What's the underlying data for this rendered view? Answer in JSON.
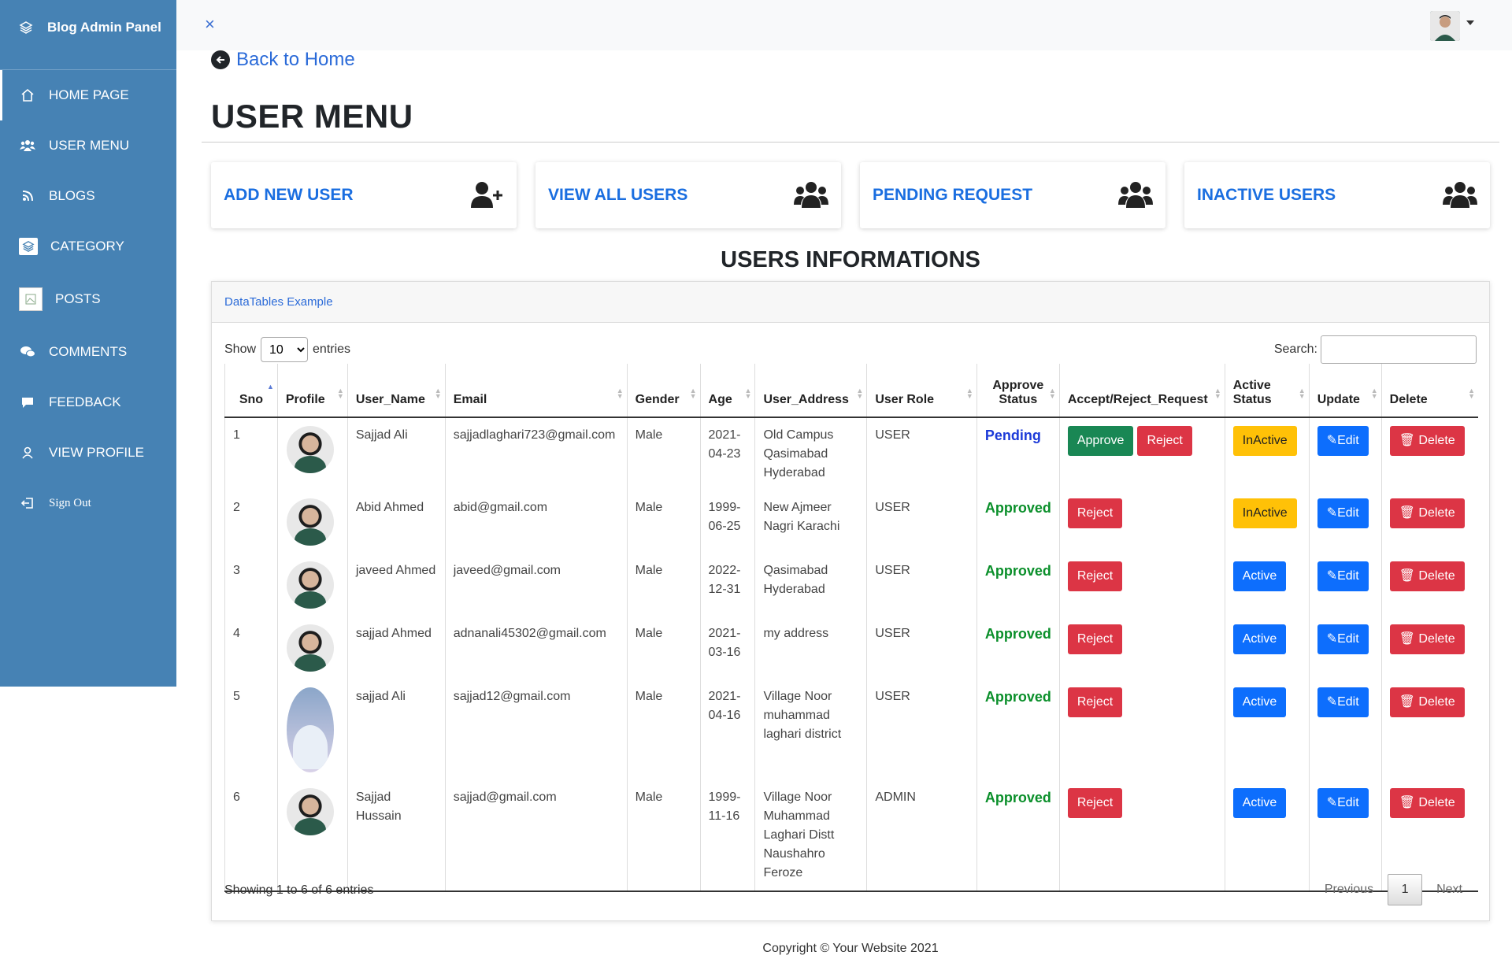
{
  "sidebar": {
    "brand": "Blog Admin Panel",
    "items": [
      {
        "label": "HOME PAGE",
        "icon": "home-icon"
      },
      {
        "label": "USER MENU",
        "icon": "users-icon"
      },
      {
        "label": "BLOGS",
        "icon": "blog-icon"
      },
      {
        "label": "CATEGORY",
        "icon": "layers-icon"
      },
      {
        "label": "POSTS",
        "icon": "broken-image-icon"
      },
      {
        "label": "COMMENTS",
        "icon": "comments-icon"
      },
      {
        "label": "FEEDBACK",
        "icon": "feedback-icon"
      },
      {
        "label": "VIEW PROFILE",
        "icon": "user-icon"
      },
      {
        "label": "Sign Out",
        "icon": "sign-out-icon"
      }
    ]
  },
  "topbar": {
    "close": "×"
  },
  "back_link": "Back to Home",
  "page_title": "USER MENU",
  "cards": [
    {
      "label": "ADD NEW USER",
      "icon": "user-plus-icon"
    },
    {
      "label": "VIEW ALL USERS",
      "icon": "users-icon"
    },
    {
      "label": "PENDING REQUEST",
      "icon": "users-icon"
    },
    {
      "label": "INACTIVE USERS",
      "icon": "users-icon"
    }
  ],
  "section_title": "USERS INFORMATIONS",
  "panel": {
    "header": "DataTables Example",
    "show_label": "Show",
    "show_value": "10",
    "entries_label": "entries",
    "search_label": "Search:",
    "columns": [
      "Sno",
      "Profile",
      "User_Name",
      "Email",
      "Gender",
      "Age",
      "User_Address",
      "User Role",
      "Approve Status",
      "Accept/Reject_Request",
      "Active Status",
      "Update",
      "Delete"
    ],
    "rows": [
      {
        "sno": "1",
        "name": "Sajjad Ali",
        "email": "sajjadlaghari723@gmail.com",
        "gender": "Male",
        "age": "2021-04-23",
        "address": "Old Campus Qasimabad Hyderabad",
        "role": "USER",
        "approve": "Pending",
        "actions": [
          "Approve",
          "Reject"
        ],
        "active": "InActive",
        "edit": "Edit",
        "delete": "Delete"
      },
      {
        "sno": "2",
        "name": "Abid Ahmed",
        "email": "abid@gmail.com",
        "gender": "Male",
        "age": "1999-06-25",
        "address": "New Ajmeer Nagri Karachi",
        "role": "USER",
        "approve": "Approved",
        "actions": [
          "Reject"
        ],
        "active": "InActive",
        "edit": "Edit",
        "delete": "Delete"
      },
      {
        "sno": "3",
        "name": "javeed Ahmed",
        "email": "javeed@gmail.com",
        "gender": "Male",
        "age": "2022-12-31",
        "address": "Qasimabad Hyderabad",
        "role": "USER",
        "approve": "Approved",
        "actions": [
          "Reject"
        ],
        "active": "Active",
        "edit": "Edit",
        "delete": "Delete"
      },
      {
        "sno": "4",
        "name": "sajjad Ahmed",
        "email": "adnanali45302@gmail.com",
        "gender": "Male",
        "age": "2021-03-16",
        "address": "my address",
        "role": "USER",
        "approve": "Approved",
        "actions": [
          "Reject"
        ],
        "active": "Active",
        "edit": "Edit",
        "delete": "Delete"
      },
      {
        "sno": "5",
        "name": "sajjad Ali",
        "email": "sajjad12@gmail.com",
        "gender": "Male",
        "age": "2021-04-16",
        "address": "Village Noor muhammad laghari district",
        "role": "USER",
        "approve": "Approved",
        "actions": [
          "Reject"
        ],
        "active": "Active",
        "edit": "Edit",
        "delete": "Delete"
      },
      {
        "sno": "6",
        "name": "Sajjad Hussain",
        "email": "sajjad@gmail.com",
        "gender": "Male",
        "age": "1999-11-16",
        "address": "Village Noor Muhammad Laghari Distt Naushahro Feroze",
        "role": "ADMIN",
        "approve": "Approved",
        "actions": [
          "Reject"
        ],
        "active": "Active",
        "edit": "Edit",
        "delete": "Delete"
      }
    ],
    "showing": "Showing 1 to 6 of 6 entries",
    "pager": {
      "previous": "Previous",
      "current": "1",
      "next": "Next"
    }
  },
  "copyright": "Copyright © Your Website 2021",
  "colors": {
    "sidebar": "#4682b4",
    "link": "#2a6ad8",
    "approve": "#198754",
    "reject": "#dc3545",
    "inactive": "#ffc107",
    "active": "#0d6efd"
  }
}
